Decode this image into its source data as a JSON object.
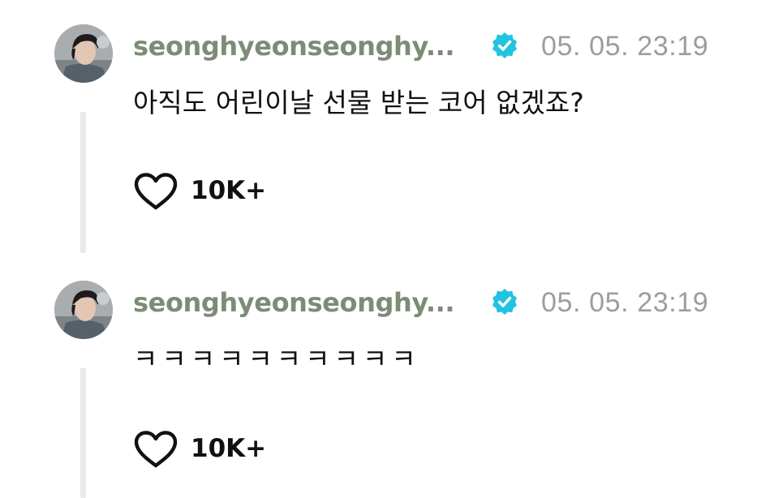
{
  "posts": [
    {
      "username": "seonghyeonseonghy...",
      "timestamp": "05. 05. 23:19",
      "text": "아직도 어린이날 선물 받는 코어 없겠죠?",
      "likes": "10K+",
      "verified": true,
      "verified_icon": "verified-badge-icon",
      "like_icon": "heart-outline-icon"
    },
    {
      "username": "seonghyeonseonghy...",
      "timestamp": "05. 05. 23:19",
      "text": "ㅋㅋㅋㅋㅋㅋㅋㅋㅋㅋ",
      "likes": "10K+",
      "verified": true,
      "verified_icon": "verified-badge-icon",
      "like_icon": "heart-outline-icon"
    }
  ],
  "colors": {
    "username": "#7c8c77",
    "timestamp": "#9d9d9d",
    "verified_badge": "#22c3e0",
    "thread_line": "#e9eaeb",
    "text": "#111111"
  }
}
